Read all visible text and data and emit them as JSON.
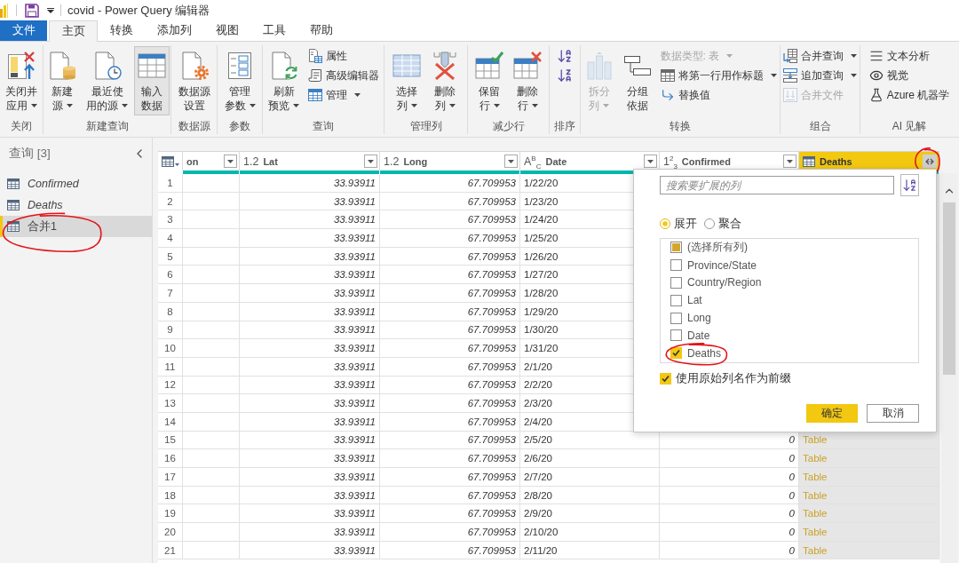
{
  "window": {
    "title": "covid - Power Query 编辑器"
  },
  "menu_tabs": [
    {
      "label": "文件",
      "kind": "file",
      "selected": false
    },
    {
      "label": "主页",
      "kind": "tab",
      "selected": true
    },
    {
      "label": "转换",
      "kind": "tab",
      "selected": false
    },
    {
      "label": "添加列",
      "kind": "tab",
      "selected": false
    },
    {
      "label": "视图",
      "kind": "tab",
      "selected": false
    },
    {
      "label": "工具",
      "kind": "tab",
      "selected": false
    },
    {
      "label": "帮助",
      "kind": "tab",
      "selected": false
    }
  ],
  "ribbon": {
    "groups": [
      {
        "label": "关闭",
        "items": [
          {
            "kind": "large",
            "lines": [
              "关闭并",
              "应用"
            ],
            "dropdown": true,
            "pressed": false,
            "disabled": false
          }
        ]
      },
      {
        "label": "新建查询",
        "items": [
          {
            "kind": "large",
            "lines": [
              "新建",
              "源"
            ],
            "dropdown": true,
            "pressed": false,
            "disabled": false
          },
          {
            "kind": "large",
            "lines": [
              "最近使",
              "用的源"
            ],
            "dropdown": true,
            "pressed": false,
            "disabled": false
          },
          {
            "kind": "large",
            "lines": [
              "输入",
              "数据"
            ],
            "dropdown": false,
            "pressed": true,
            "disabled": false
          }
        ]
      },
      {
        "label": "数据源",
        "items": [
          {
            "kind": "large",
            "lines": [
              "数据源",
              "设置"
            ],
            "dropdown": false,
            "pressed": false,
            "disabled": false
          }
        ]
      },
      {
        "label": "参数",
        "items": [
          {
            "kind": "large",
            "lines": [
              "管理",
              "参数"
            ],
            "dropdown": true,
            "pressed": false,
            "disabled": false
          }
        ]
      },
      {
        "label": "查询",
        "items": [
          {
            "kind": "large",
            "lines": [
              "刷新",
              "预览"
            ],
            "dropdown": true,
            "pressed": false,
            "disabled": false
          },
          {
            "kind": "stack",
            "items": [
              {
                "kind": "small",
                "label": "属性",
                "dropdown": false,
                "pressed": false,
                "disabled": false
              },
              {
                "kind": "small",
                "label": "高级编辑器",
                "dropdown": false,
                "pressed": false,
                "disabled": false
              },
              {
                "kind": "small",
                "label": "管理",
                "dropdown": true,
                "pressed": false,
                "disabled": false
              }
            ]
          }
        ]
      },
      {
        "label": "管理列",
        "items": [
          {
            "kind": "large",
            "lines": [
              "选择",
              "列"
            ],
            "dropdown": true,
            "pressed": false,
            "disabled": false
          },
          {
            "kind": "large",
            "lines": [
              "删除",
              "列"
            ],
            "dropdown": true,
            "pressed": false,
            "disabled": false
          }
        ]
      },
      {
        "label": "减少行",
        "items": [
          {
            "kind": "large",
            "lines": [
              "保留",
              "行"
            ],
            "dropdown": true,
            "pressed": false,
            "disabled": false
          },
          {
            "kind": "large",
            "lines": [
              "删除",
              "行"
            ],
            "dropdown": true,
            "pressed": false,
            "disabled": false
          }
        ]
      },
      {
        "label": "排序",
        "items": [
          {
            "kind": "stack",
            "items": [
              {
                "kind": "icon",
                "dropdown": false,
                "pressed": false,
                "disabled": false
              },
              {
                "kind": "icon",
                "dropdown": false,
                "pressed": false,
                "disabled": false
              }
            ]
          }
        ]
      },
      {
        "label": "转换",
        "items": [
          {
            "kind": "large",
            "lines": [
              "拆分",
              "列"
            ],
            "dropdown": true,
            "pressed": false,
            "disabled": true
          },
          {
            "kind": "large",
            "lines": [
              "分组",
              "依据"
            ],
            "dropdown": false,
            "pressed": false,
            "disabled": false
          },
          {
            "kind": "stack",
            "items": [
              {
                "kind": "small",
                "label": "数据类型: 表",
                "dropdown": true,
                "pressed": false,
                "disabled": true
              },
              {
                "kind": "small",
                "label": "将第一行用作标题",
                "dropdown": true,
                "pressed": false,
                "disabled": false
              },
              {
                "kind": "small",
                "label": "替换值",
                "dropdown": false,
                "pressed": false,
                "disabled": false
              }
            ]
          }
        ]
      },
      {
        "label": "组合",
        "items": [
          {
            "kind": "stack",
            "items": [
              {
                "kind": "small",
                "label": "合并查询",
                "dropdown": true,
                "pressed": false,
                "disabled": false
              },
              {
                "kind": "small",
                "label": "追加查询",
                "dropdown": true,
                "pressed": false,
                "disabled": false
              },
              {
                "kind": "small",
                "label": "合并文件",
                "dropdown": false,
                "pressed": false,
                "disabled": true
              }
            ]
          }
        ]
      },
      {
        "label": "AI 见解",
        "items": [
          {
            "kind": "stack",
            "items": [
              {
                "kind": "small",
                "label": "文本分析",
                "dropdown": false,
                "pressed": false,
                "disabled": false
              },
              {
                "kind": "small",
                "label": "视觉",
                "dropdown": false,
                "pressed": false,
                "disabled": false
              },
              {
                "kind": "small",
                "label": "Azure 机器学",
                "dropdown": false,
                "pressed": false,
                "disabled": false
              }
            ]
          }
        ]
      }
    ]
  },
  "queries": {
    "title": "查询 [3]",
    "items": [
      {
        "label": "Confirmed",
        "loaded": false,
        "selected": false,
        "circled": false
      },
      {
        "label": "Deaths",
        "loaded": false,
        "selected": false,
        "circled": false
      },
      {
        "label": "合并1",
        "loaded": true,
        "selected": true,
        "circled": true
      }
    ]
  },
  "grid": {
    "columns": [
      {
        "kind": "partial",
        "name": "on",
        "selected": false,
        "circled": false
      },
      {
        "kind": "number",
        "type_label": "1.2",
        "name": "Lat",
        "selected": false,
        "circled": false
      },
      {
        "kind": "number",
        "type_label": "1.2",
        "name": "Long",
        "selected": false,
        "circled": false
      },
      {
        "kind": "text",
        "type_label": "A$^{B}$$_{C}$",
        "name": "Date",
        "selected": false,
        "circled": false
      },
      {
        "kind": "number",
        "type_label": "1$^{2}$$_{3}$",
        "name": "Confirmed",
        "selected": false,
        "circled": false
      },
      {
        "kind": "table",
        "name": "Deaths",
        "selected": true,
        "circled": true
      }
    ],
    "rows": [
      {
        "number": "1",
        "lat": "33.93911",
        "long": "67.709953",
        "date": "1/22/20"
      },
      {
        "number": "2",
        "lat": "33.93911",
        "long": "67.709953",
        "date": "1/23/20"
      },
      {
        "number": "3",
        "lat": "33.93911",
        "long": "67.709953",
        "date": "1/24/20"
      },
      {
        "number": "4",
        "lat": "33.93911",
        "long": "67.709953",
        "date": "1/25/20"
      },
      {
        "number": "5",
        "lat": "33.93911",
        "long": "67.709953",
        "date": "1/26/20"
      },
      {
        "number": "6",
        "lat": "33.93911",
        "long": "67.709953",
        "date": "1/27/20"
      },
      {
        "number": "7",
        "lat": "33.93911",
        "long": "67.709953",
        "date": "1/28/20"
      },
      {
        "number": "8",
        "lat": "33.93911",
        "long": "67.709953",
        "date": "1/29/20"
      },
      {
        "number": "9",
        "lat": "33.93911",
        "long": "67.709953",
        "date": "1/30/20"
      },
      {
        "number": "10",
        "lat": "33.93911",
        "long": "67.709953",
        "date": "1/31/20"
      },
      {
        "number": "11",
        "lat": "33.93911",
        "long": "67.709953",
        "date": "2/1/20"
      },
      {
        "number": "12",
        "lat": "33.93911",
        "long": "67.709953",
        "date": "2/2/20"
      },
      {
        "number": "13",
        "lat": "33.93911",
        "long": "67.709953",
        "date": "2/3/20"
      },
      {
        "number": "14",
        "lat": "33.93911",
        "long": "67.709953",
        "date": "2/4/20"
      },
      {
        "number": "15",
        "lat": "33.93911",
        "long": "67.709953",
        "date": "2/5/20",
        "confirmed": "0",
        "deaths": "Table"
      },
      {
        "number": "16",
        "lat": "33.93911",
        "long": "67.709953",
        "date": "2/6/20",
        "confirmed": "0",
        "deaths": "Table"
      },
      {
        "number": "17",
        "lat": "33.93911",
        "long": "67.709953",
        "date": "2/7/20",
        "confirmed": "0",
        "deaths": "Table"
      },
      {
        "number": "18",
        "lat": "33.93911",
        "long": "67.709953",
        "date": "2/8/20",
        "confirmed": "0",
        "deaths": "Table"
      },
      {
        "number": "19",
        "lat": "33.93911",
        "long": "67.709953",
        "date": "2/9/20",
        "confirmed": "0",
        "deaths": "Table"
      },
      {
        "number": "20",
        "lat": "33.93911",
        "long": "67.709953",
        "date": "2/10/20",
        "confirmed": "0",
        "deaths": "Table"
      },
      {
        "number": "21",
        "lat": "33.93911",
        "long": "67.709953",
        "date": "2/11/20",
        "confirmed": "0",
        "deaths": "Table"
      }
    ]
  },
  "expand_popup": {
    "search": {
      "placeholder": "搜索要扩展的列"
    },
    "modes": [
      {
        "label": "展开",
        "selected": true
      },
      {
        "label": "聚合",
        "selected": false
      }
    ],
    "select_all": {
      "label": "(选择所有列)",
      "indeterminate": true
    },
    "options": [
      {
        "label": "Province/State",
        "checked": false,
        "circled": false
      },
      {
        "label": "Country/Region",
        "checked": false,
        "circled": false
      },
      {
        "label": "Lat",
        "checked": false,
        "circled": false
      },
      {
        "label": "Long",
        "checked": false,
        "circled": false
      },
      {
        "label": "Date",
        "checked": false,
        "circled": false
      },
      {
        "label": "Deaths",
        "checked": true,
        "circled": true
      }
    ],
    "prefix": {
      "label": "使用原始列名作为前缀",
      "checked": true
    },
    "buttons": [
      {
        "label": "确定",
        "kind": "primary"
      },
      {
        "label": "取消",
        "kind": "secondary"
      }
    ]
  }
}
